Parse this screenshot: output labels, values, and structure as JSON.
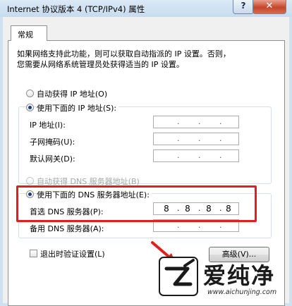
{
  "window": {
    "title": "Internet 协议版本 4 (TCP/IPv4) 属性",
    "help_glyph": "?",
    "close_glyph": "✕"
  },
  "tab": {
    "label": "常规"
  },
  "description": {
    "line1": "如果网络支持此功能，则可以获取自动指派的 IP 设置。否则，",
    "line2": "您需要从网络系统管理员处获得适当的 IP 设置。"
  },
  "ip_section": {
    "auto_label": "自动获得 IP 地址(O)",
    "manual_label": "使用下面的 IP 地址(S):",
    "selected": "manual",
    "fields": [
      {
        "label": "IP 地址(I):",
        "octets": [
          "",
          "",
          "",
          ""
        ]
      },
      {
        "label": "子网掩码(U):",
        "octets": [
          "",
          "",
          "",
          ""
        ]
      },
      {
        "label": "默认网关(D):",
        "octets": [
          "",
          "",
          "",
          ""
        ]
      }
    ]
  },
  "dns_section": {
    "auto_label": "自动获得 DNS 服务器地址(B)",
    "manual_label": "使用下面的 DNS 服务器地址(E):",
    "selected": "manual",
    "preferred": {
      "label": "首选 DNS 服务器(P):",
      "octets": [
        "8",
        "8",
        "8",
        "8"
      ]
    },
    "alternate": {
      "label": "备用 DNS 服务器(A):",
      "octets": [
        "",
        "",
        "",
        ""
      ]
    }
  },
  "validate_on_exit": {
    "label": "退出时验证设置(L)",
    "checked": false
  },
  "advanced_button": {
    "label": "高级(V)..."
  },
  "watermark": {
    "brand": "爱纯净",
    "url": "www.aichunjing.com"
  },
  "colors": {
    "highlight": "#e02020",
    "titlebar": "#cfe0f1",
    "close": "#c5452c"
  }
}
